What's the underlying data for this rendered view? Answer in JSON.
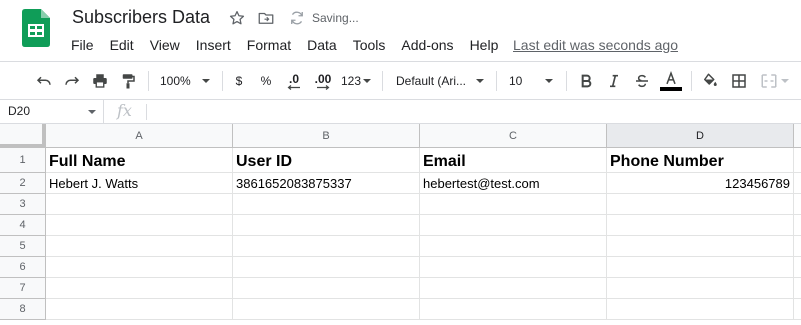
{
  "app": {
    "doc_title": "Subscribers Data",
    "saving_status": "Saving...",
    "last_edit": "Last edit was seconds ago",
    "brand_color": "#0f9d58"
  },
  "menu": [
    "File",
    "Edit",
    "View",
    "Insert",
    "Format",
    "Data",
    "Tools",
    "Add-ons",
    "Help"
  ],
  "toolbar": {
    "zoom": "100%",
    "currency": "$",
    "percent": "%",
    "decrease_decimal": ".0",
    "increase_decimal": ".00",
    "more_formats": "123",
    "font": "Default (Ari...",
    "font_size": "10",
    "icons": [
      "undo-icon",
      "redo-icon",
      "print-icon",
      "paint-format-icon",
      "bold-icon",
      "italic-icon",
      "strikethrough-icon",
      "text-color-icon",
      "fill-color-icon",
      "borders-icon",
      "merge-cells-icon"
    ]
  },
  "formula_bar": {
    "cell_ref": "D20",
    "fx_label": "fx",
    "value": ""
  },
  "sheet": {
    "columns": [
      "A",
      "B",
      "C",
      "D"
    ],
    "rows": [
      "1",
      "2",
      "3",
      "4",
      "5",
      "6",
      "7",
      "8"
    ],
    "header_row": [
      "Full Name",
      "User ID",
      "Email",
      "Phone Number"
    ],
    "data_rows": [
      [
        "Hebert J. Watts",
        "3861652083875337",
        "hebertest@test.com",
        "123456789"
      ]
    ],
    "active_column": "D"
  }
}
